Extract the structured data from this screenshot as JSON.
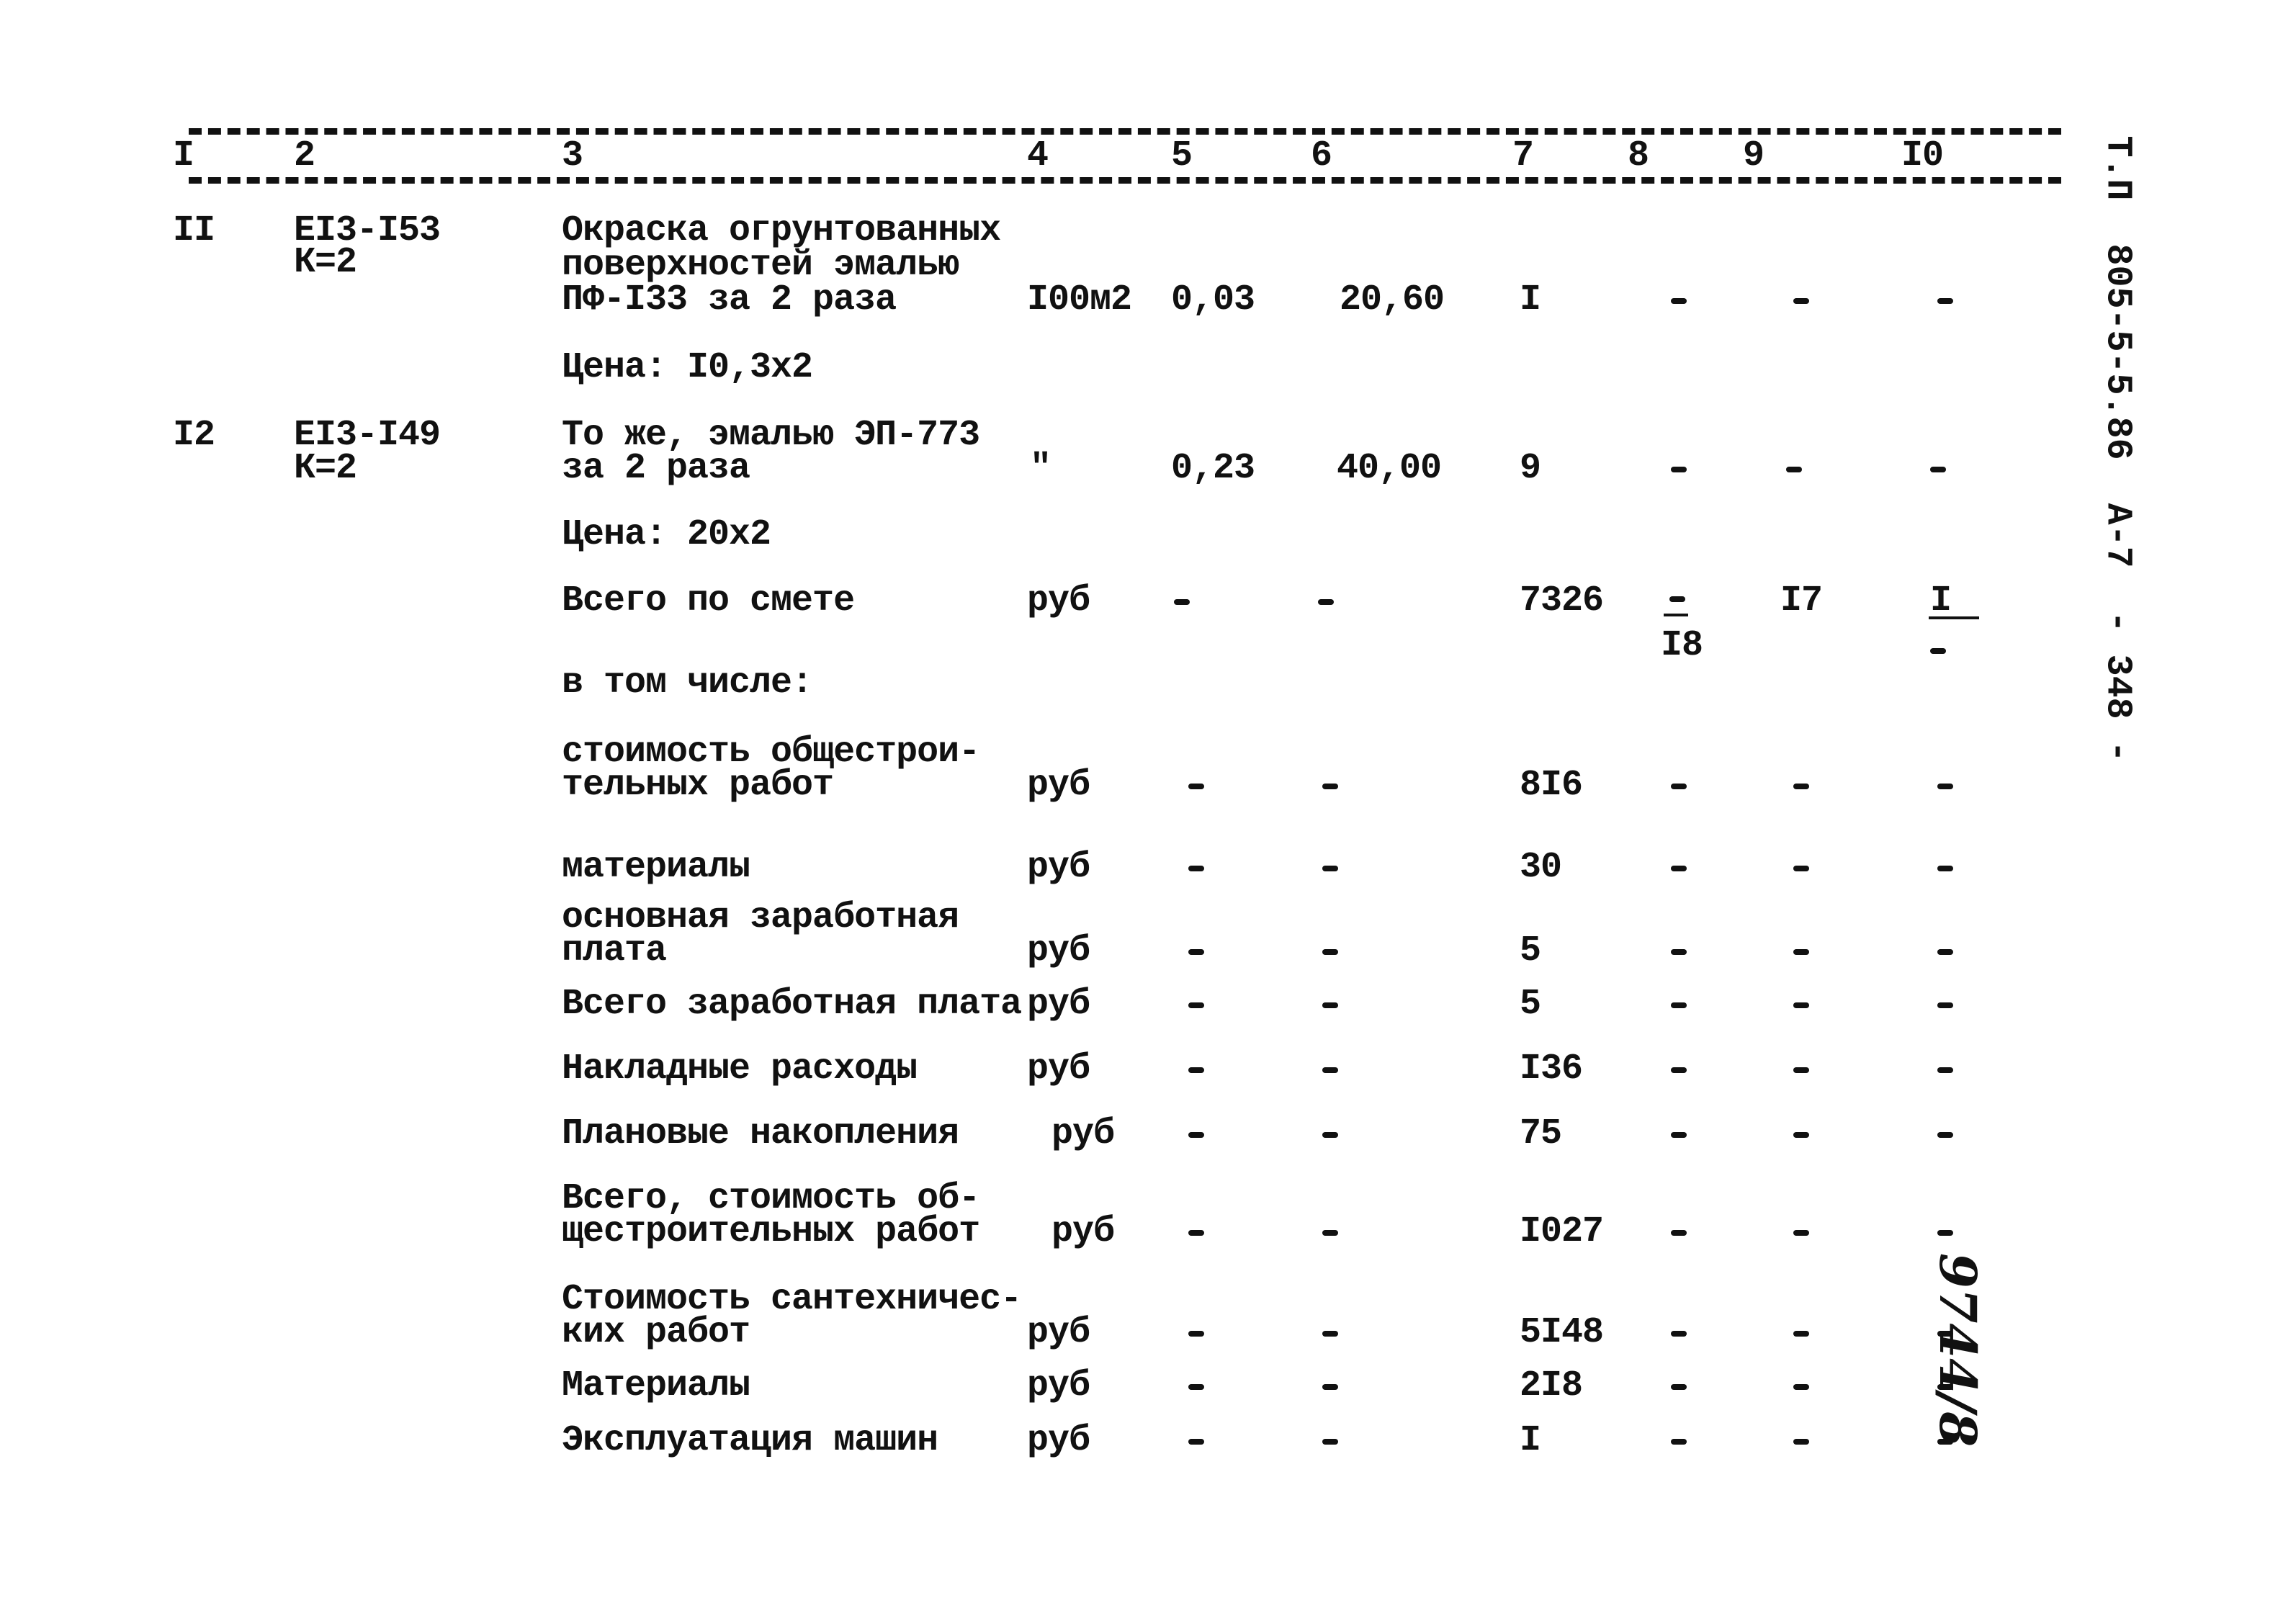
{
  "header": {
    "columns": [
      "I",
      "2",
      "3",
      "4",
      "5",
      "6",
      "7",
      "8",
      "9",
      "I0"
    ]
  },
  "side_stamp": {
    "text": "Т.П  805-5-5.86  А-7  - 348 -"
  },
  "handwritten_note": "9744/8",
  "rows": [
    {
      "num": "II",
      "code_line1": "EI3-I53",
      "code_line2": "К=2",
      "desc_lines": [
        "Окраска огрунтованных",
        "поверхностей эмалью",
        "ПФ-I33 за 2 раза"
      ],
      "unit": "I00м2",
      "c5": "0,03",
      "c6": "20,60",
      "c7": "I",
      "c8": "–",
      "c9": "–",
      "c10": "–",
      "price_note": "Цена: I0,3x2"
    },
    {
      "num": "I2",
      "code_line1": "EI3-I49",
      "code_line2": "К=2",
      "desc_lines": [
        "То же, эмалью ЭП-773",
        "за 2 раза"
      ],
      "unit": "\"",
      "c5": "0,23",
      "c6": "40,00",
      "c7": "9",
      "c8": "–",
      "c9": "–",
      "c10": "–",
      "price_note": "Цена: 20x2"
    }
  ],
  "total": {
    "label": "Всего по смете",
    "unit": "руб",
    "c5": "–",
    "c6": "–",
    "c7": "7326",
    "c8_top": "–",
    "c8_bottom": "I8",
    "c9": "I7",
    "c10_top": "I",
    "c10_bottom": "–"
  },
  "including_label": "в том числе:",
  "summary": [
    {
      "lines": [
        "стоимость общестрои-",
        "тельных работ"
      ],
      "unit": "руб",
      "c5": "–",
      "c6": "–",
      "c7": "8I6",
      "c8": "–",
      "c9": "–",
      "c10": "–"
    },
    {
      "lines": [
        "материалы"
      ],
      "unit": "руб",
      "c5": "–",
      "c6": "–",
      "c7": "30",
      "c8": "–",
      "c9": "–",
      "c10": "–"
    },
    {
      "lines": [
        "основная заработная",
        "плата"
      ],
      "unit": "руб",
      "c5": "–",
      "c6": "–",
      "c7": "5",
      "c8": "–",
      "c9": "–",
      "c10": "–"
    },
    {
      "lines": [
        "Всего заработная плата"
      ],
      "unit": "руб",
      "c5": "–",
      "c6": "–",
      "c7": "5",
      "c8": "–",
      "c9": "–",
      "c10": "–"
    },
    {
      "lines": [
        "Накладные расходы"
      ],
      "unit": "руб",
      "c5": "–",
      "c6": "–",
      "c7": "I36",
      "c8": "–",
      "c9": "–",
      "c10": "–"
    },
    {
      "lines": [
        "Плановые накопления"
      ],
      "unit": "руб",
      "c5": "–",
      "c6": "–",
      "c7": "75",
      "c8": "–",
      "c9": "–",
      "c10": "–"
    },
    {
      "lines": [
        "Всего, стоимость об-",
        "щестроительных работ"
      ],
      "unit": "руб",
      "c5": "–",
      "c6": "–",
      "c7": "I027",
      "c8": "–",
      "c9": "–",
      "c10": "–"
    },
    {
      "lines": [
        "Стоимость сантехничес-",
        "ких работ"
      ],
      "unit": "руб",
      "c5": "–",
      "c6": "–",
      "c7": "5I48",
      "c8": "–",
      "c9": "–",
      "c10": "–"
    },
    {
      "lines": [
        "Материалы"
      ],
      "unit": "руб",
      "c5": "–",
      "c6": "–",
      "c7": "2I8",
      "c8": "–",
      "c9": "–",
      "c10": "–"
    },
    {
      "lines": [
        "Эксплуатация машин"
      ],
      "unit": "руб",
      "c5": "–",
      "c6": "–",
      "c7": "I",
      "c8": "–",
      "c9": "–",
      "c10": "–"
    }
  ]
}
